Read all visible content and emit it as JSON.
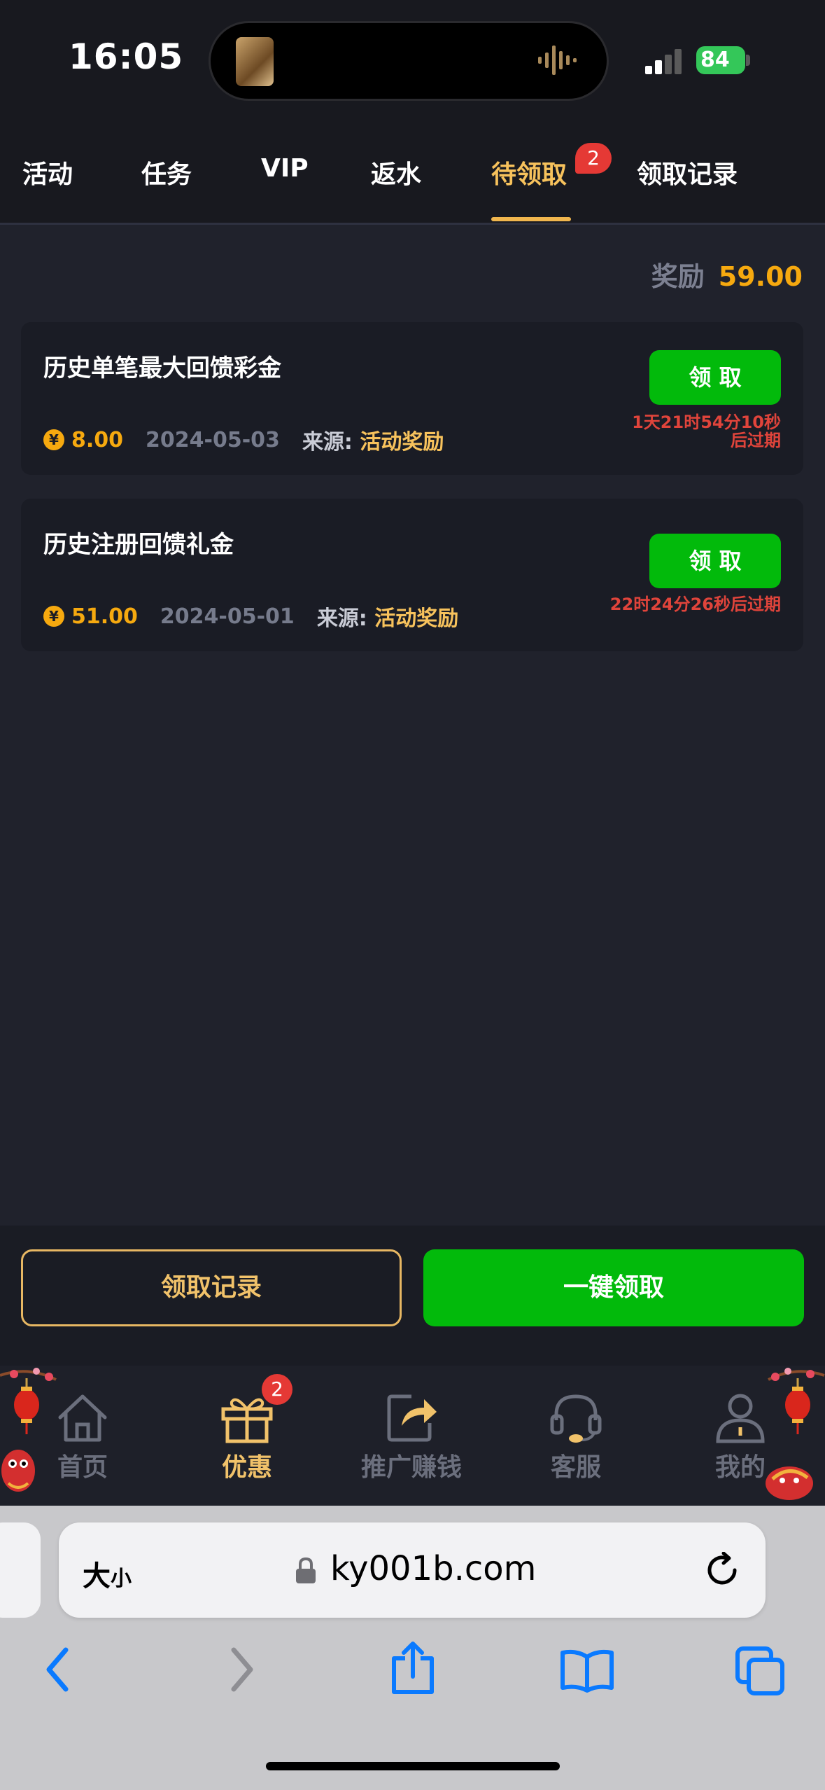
{
  "status": {
    "time": "16:05",
    "battery": "84"
  },
  "tabs": [
    {
      "label": "活动"
    },
    {
      "label": "任务"
    },
    {
      "label": "VIP"
    },
    {
      "label": "返水"
    },
    {
      "label": "待领取",
      "active": true,
      "badge": "2"
    },
    {
      "label": "领取记录"
    }
  ],
  "summary": {
    "label": "奖励",
    "value": "59.00"
  },
  "rewards": [
    {
      "title": "历史单笔最大回馈彩金",
      "amount": "8.00",
      "date": "2024-05-03",
      "source_label": "来源:",
      "source": "活动奖励",
      "button": "领 取",
      "expire_line1": "1天21时54分10秒",
      "expire_line2": "后过期"
    },
    {
      "title": "历史注册回馈礼金",
      "amount": "51.00",
      "date": "2024-05-01",
      "source_label": "来源:",
      "source": "活动奖励",
      "button": "领 取",
      "expire_line1": "22时24分26秒后过期",
      "expire_line2": ""
    }
  ],
  "coin_symbol": "¥",
  "actions": {
    "records": "领取记录",
    "claim_all": "一键领取"
  },
  "nav": [
    {
      "label": "首页",
      "icon": "home-icon"
    },
    {
      "label": "优惠",
      "icon": "gift-icon",
      "active": true,
      "badge": "2"
    },
    {
      "label": "推广赚钱",
      "icon": "share-icon"
    },
    {
      "label": "客服",
      "icon": "headset-icon"
    },
    {
      "label": "我的",
      "icon": "user-icon"
    }
  ],
  "browser": {
    "text_size_big": "大",
    "text_size_small": "小",
    "url": "ky001b.com"
  },
  "colors": {
    "accent_gold": "#f6a90f",
    "green": "#02ba0b",
    "red": "#e53935",
    "bg": "#20222c"
  }
}
